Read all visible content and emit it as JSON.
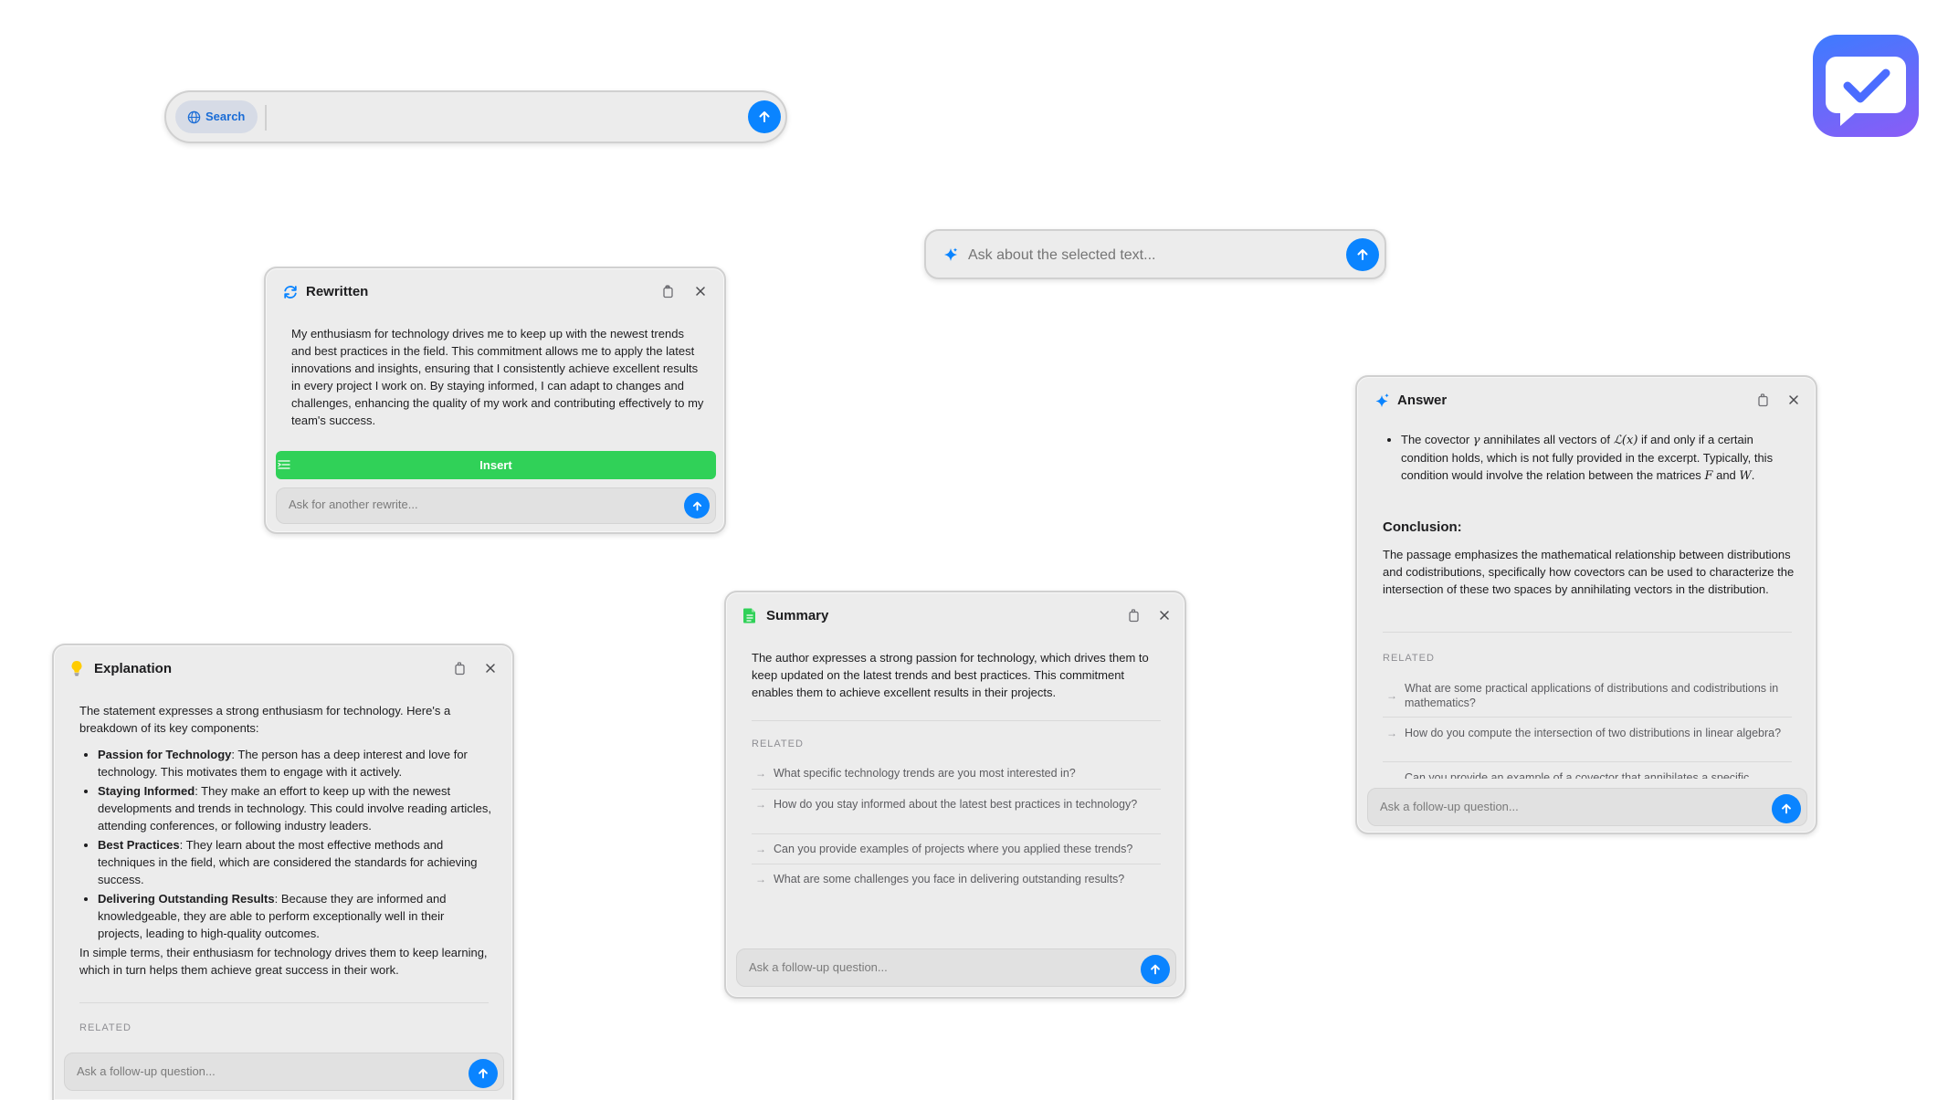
{
  "search_bar": {
    "search_chip_label": "Search",
    "input_value": ""
  },
  "ask_selected": {
    "placeholder": "Ask about the selected text..."
  },
  "rewritten": {
    "title": "Rewritten",
    "text": "My enthusiasm for technology drives me to keep up with the newest trends and best practices in the field. This commitment allows me to apply the latest innovations and insights, ensuring that I consistently achieve excellent results in every project I work on. By staying informed, I can adapt to changes and challenges, enhancing the quality of my work and contributing effectively to my team's success.",
    "insert_label": "Insert",
    "followup_placeholder": "Ask for another rewrite..."
  },
  "summary": {
    "title": "Summary",
    "text": "The author expresses a strong passion for technology, which drives them to keep updated on the latest trends and best practices. This commitment enables them to achieve excellent results in their projects.",
    "related_label": "RELATED",
    "related": [
      "What specific technology trends are you most interested in?",
      "How do you stay informed about the latest best practices in technology?",
      "Can you provide examples of projects where you applied these trends?",
      "What are some challenges you face in delivering outstanding results?"
    ],
    "followup_placeholder": "Ask a follow-up question..."
  },
  "answer": {
    "title": "Answer",
    "bullet_text_1": "The covector",
    "bullet_sym_gamma": "γ",
    "bullet_text_2": "annihilates all vectors of",
    "bullet_sym_L": "ℒ(x)",
    "bullet_text_3": "if and only if a certain condition holds, which is not fully provided in the excerpt. Typically, this condition would involve the relation between the matrices",
    "bullet_sym_F": "F",
    "bullet_text_and": "and",
    "bullet_sym_W": "W",
    "bullet_text_end": ".",
    "conclusion_heading": "Conclusion:",
    "conclusion_text": "The passage emphasizes the mathematical relationship between distributions and codistributions, specifically how covectors can be used to characterize the intersection of these two spaces by annihilating vectors in the distribution.",
    "related_label": "RELATED",
    "related": [
      "What are some practical applications of distributions and codistributions in mathematics?",
      "How do you compute the intersection of two distributions in linear algebra?",
      "Can you provide an example of a covector that annihilates a specific"
    ],
    "followup_placeholder": "Ask a follow-up question..."
  },
  "explanation": {
    "title": "Explanation",
    "intro": "The statement expresses a strong enthusiasm for technology. Here's a breakdown of its key components:",
    "items": [
      {
        "term": "Passion for Technology",
        "desc": ": The person has a deep interest and love for technology. This motivates them to engage with it actively."
      },
      {
        "term": "Staying Informed",
        "desc": ": They make an effort to keep up with the newest developments and trends in technology. This could involve reading articles, attending conferences, or following industry leaders."
      },
      {
        "term": "Best Practices",
        "desc": ": They learn about the most effective methods and techniques in the field, which are considered the standards for achieving success."
      },
      {
        "term": "Delivering Outstanding Results",
        "desc": ": Because they are informed and knowledgeable, they are able to perform exceptionally well in their projects, leading to high-quality outcomes."
      }
    ],
    "outro": "In simple terms, their enthusiasm for technology drives them to keep learning, which in turn helps them achieve great success in their work.",
    "related_label": "RELATED",
    "followup_placeholder": "Ask a follow-up question..."
  },
  "colors": {
    "accent": "#0a84ff",
    "insert_green": "#30d158",
    "app_icon_gradient_start": "#3d7bff",
    "app_icon_gradient_end": "#8b5cf6"
  },
  "icons": {
    "app": "speech-bubble-checkmark-icon",
    "search_chip": "globe-icon",
    "ask": "sparkle-icon",
    "rewritten": "refresh-icon",
    "summary": "document-icon",
    "answer": "sparkle-icon",
    "explanation": "lightbulb-icon"
  }
}
